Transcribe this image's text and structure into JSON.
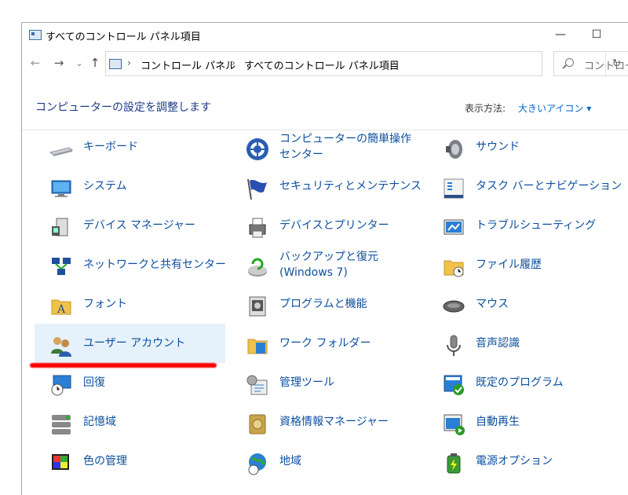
{
  "window": {
    "title": "すべてのコントロール パネル項目",
    "minimize": "—",
    "maximize": "☐",
    "close": "✕"
  },
  "nav": {
    "back": "←",
    "forward": "→",
    "recent": "⌄",
    "up": "↑",
    "breadcrumb": [
      "コントロール パネル",
      "すべてのコントロール パネル項目"
    ],
    "refresh": "↻",
    "search_placeholder": "コントロール"
  },
  "header": {
    "title": "コンピューターの設定を調整します",
    "viewby_label": "表示方法:",
    "viewby_value": "大きいアイコン ▾"
  },
  "items": [
    {
      "label": "キーボード",
      "icon": "keyboard-icon"
    },
    {
      "label": "コンピューターの簡単操作センター",
      "icon": "ease-of-access-icon"
    },
    {
      "label": "サウンド",
      "icon": "speaker-icon"
    },
    {
      "label": "システム",
      "icon": "computer-icon"
    },
    {
      "label": "セキュリティとメンテナンス",
      "icon": "flag-icon"
    },
    {
      "label": "タスク バーとナビゲーション",
      "icon": "taskbar-icon"
    },
    {
      "label": "デバイス マネージャー",
      "icon": "device-manager-icon"
    },
    {
      "label": "デバイスとプリンター",
      "icon": "printer-icon"
    },
    {
      "label": "トラブルシューティング",
      "icon": "troubleshoot-icon"
    },
    {
      "label": "ネットワークと共有センター",
      "icon": "network-icon"
    },
    {
      "label": "バックアップと復元 (Windows 7)",
      "icon": "backup-icon"
    },
    {
      "label": "ファイル履歴",
      "icon": "file-history-icon"
    },
    {
      "label": "フォント",
      "icon": "font-folder-icon"
    },
    {
      "label": "プログラムと機能",
      "icon": "programs-icon"
    },
    {
      "label": "マウス",
      "icon": "mouse-icon"
    },
    {
      "label": "ユーザー アカウント",
      "icon": "user-accounts-icon"
    },
    {
      "label": "ワーク フォルダー",
      "icon": "work-folders-icon"
    },
    {
      "label": "音声認識",
      "icon": "microphone-icon"
    },
    {
      "label": "回復",
      "icon": "recovery-icon"
    },
    {
      "label": "管理ツール",
      "icon": "admin-tools-icon"
    },
    {
      "label": "既定のプログラム",
      "icon": "default-programs-icon"
    },
    {
      "label": "記憶域",
      "icon": "storage-icon"
    },
    {
      "label": "資格情報マネージャー",
      "icon": "credential-icon"
    },
    {
      "label": "自動再生",
      "icon": "autoplay-icon"
    },
    {
      "label": "色の管理",
      "icon": "color-management-icon"
    },
    {
      "label": "地域",
      "icon": "globe-icon"
    },
    {
      "label": "電源オプション",
      "icon": "power-icon"
    }
  ],
  "colors": {
    "link": "#0b4f9e",
    "selected_bg": "#e5f1fb",
    "highlight": "#ff0000"
  }
}
